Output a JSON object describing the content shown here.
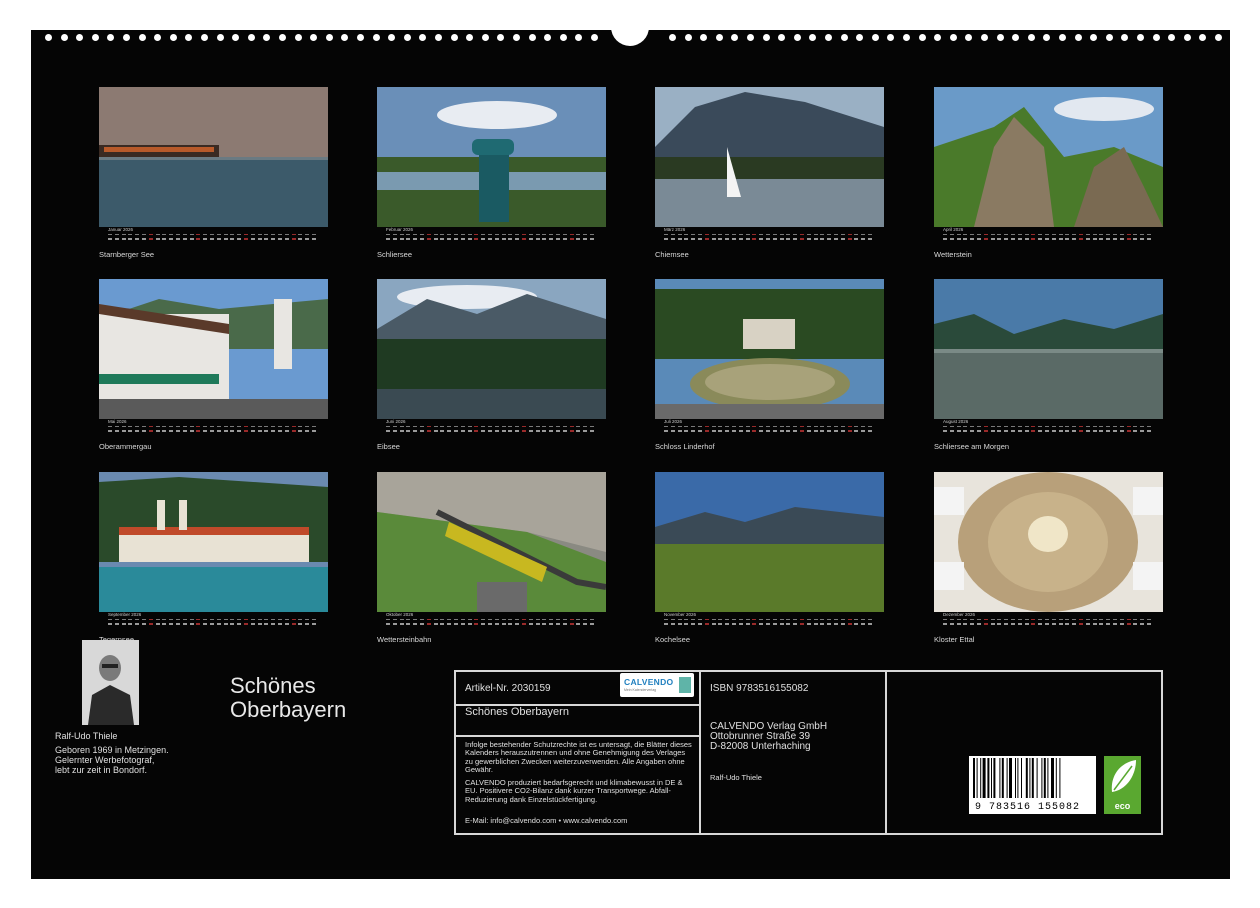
{
  "calendar": {
    "year": "2026",
    "months": [
      {
        "month": "Januar",
        "caption": "Starnberger See"
      },
      {
        "month": "Februar",
        "caption": "Schliersee"
      },
      {
        "month": "März",
        "caption": "Chiemsee"
      },
      {
        "month": "April",
        "caption": "Wetterstein"
      },
      {
        "month": "Mai",
        "caption": "Oberammergau"
      },
      {
        "month": "Juni",
        "caption": "Eibsee"
      },
      {
        "month": "Juli",
        "caption": "Schloss Linderhof"
      },
      {
        "month": "August",
        "caption": "Schliersee am Morgen"
      },
      {
        "month": "September",
        "caption": "Tegernsee"
      },
      {
        "month": "Oktober",
        "caption": "Wettersteinbahn"
      },
      {
        "month": "November",
        "caption": "Kochelsee"
      },
      {
        "month": "Dezember",
        "caption": "Kloster Ettal"
      }
    ]
  },
  "book": {
    "title_line1": "Schönes",
    "title_line2": "Oberbayern"
  },
  "author": {
    "name": "Ralf-Udo Thiele",
    "bio_line1": "Geboren 1969 in Metzingen.",
    "bio_line2": "Gelernter Werbefotograf,",
    "bio_line3": "lebt zur zeit in Bondorf."
  },
  "info": {
    "article": "Artikel-Nr. 2030159",
    "product_title": "Schönes Oberbayern",
    "legal": "Infolge bestehender Schutzrechte ist es untersagt, die Blätter dieses Kalenders herauszutrennen und ohne Genehmigung des Verlages zu gewerblichen Zwecken weiterzuverwenden. Alle Angaben ohne Gewähr.",
    "eco_note": "CALVENDO produziert bedarfsgerecht und klimabewusst in DE & EU. Positivere CO2-Bilanz dank kurzer Transportwege. Abfall-Reduzierung dank Einzelstückfertigung.",
    "contact": "E-Mail: info@calvendo.com • www.calvendo.com",
    "isbn": "ISBN 9783516155082",
    "publisher_name": "CALVENDO Verlag GmbH",
    "publisher_street": "Ottobrunner Straße 39",
    "publisher_city": "D-82008 Unterhaching",
    "photographer": "Ralf-Udo Thiele",
    "logo_text": "CALVENDO",
    "logo_sub": "Mein Kalenderverlag",
    "barcode_number": "9 783516 155082",
    "eco_label": "eco"
  },
  "colors": {
    "background": "#050505",
    "frame": "#d8d8d8",
    "text": "#e0e0e0",
    "eco_green": "#5aa830",
    "logo_blue": "#1f7fbf"
  }
}
